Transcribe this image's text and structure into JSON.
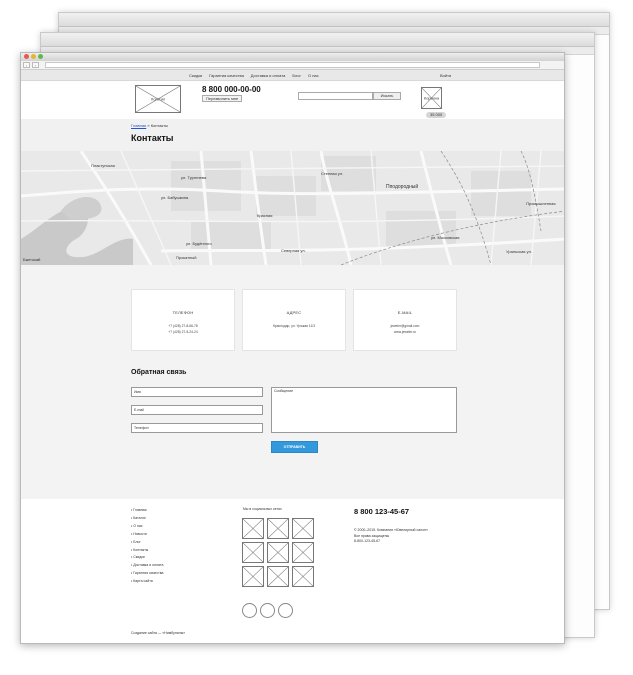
{
  "topnav": {
    "items": [
      "Скидки",
      "Гарантия качества",
      "Доставка и оплата",
      "Блог",
      "О нас"
    ],
    "login": "Войти"
  },
  "header": {
    "logo_label": "Логотип",
    "phone": "8 800 000-00-00",
    "callback_label": "Перезвонить мне",
    "search_button": "Искать",
    "search_placeholder": "",
    "cart_label": "Корзина",
    "cart_sum": "35 000"
  },
  "breadcrumbs": {
    "home": "Главная",
    "separator": "»",
    "current": "Контакты"
  },
  "page_title": "Контакты",
  "map": {
    "labels": [
      "Пластунская",
      "ул. Тургенева",
      "ул. Бабушкина",
      "Красная",
      "Северная ул.",
      "Прокатный",
      "Пподородный",
      "Уральская ул.",
      "Бжегокай",
      "Степная ул.",
      "ул. Будённого",
      "ул. Московская",
      "Промышленная"
    ]
  },
  "contacts": {
    "cards": [
      {
        "title": "ТЕЛЕФОН",
        "lines": [
          "+7 (428) 27-8-66-78",
          "+7 (428) 27-5-24-24"
        ]
      },
      {
        "title": "АДРЕС",
        "lines": [
          "Краснодар, ул. Урожая 11/3"
        ]
      },
      {
        "title": "E-MAIL",
        "lines": [
          "jeweler@gmail.com",
          "www.jeweler.ru"
        ]
      }
    ]
  },
  "feedback": {
    "title": "Обратная связь",
    "name_placeholder": "Имя",
    "email_placeholder": "E-mail",
    "phone_placeholder": "Телефон",
    "message_placeholder": "Сообщение",
    "submit_label": "ОТПРАВИТЬ"
  },
  "footer": {
    "links": [
      "Главная",
      "Каталог",
      "О нас",
      "Новости",
      "Блог",
      "Контакты",
      "Скидки",
      "Доставка и оплата",
      "Гарантия качества",
      "Карта сайта"
    ],
    "social_title": "Мы в социальных сетях",
    "phone": "8 800 123-45-67",
    "copyright_lines": [
      "© 2000–2015. Компания «Ювелирный салон»",
      "Все права защищены",
      "8-800-123-45-67"
    ],
    "credit": "Создание сайта — «Нимбупилы»"
  },
  "colors": {
    "accent": "#3299dc",
    "band": "#f1f1f1",
    "link": "#2255cc"
  }
}
